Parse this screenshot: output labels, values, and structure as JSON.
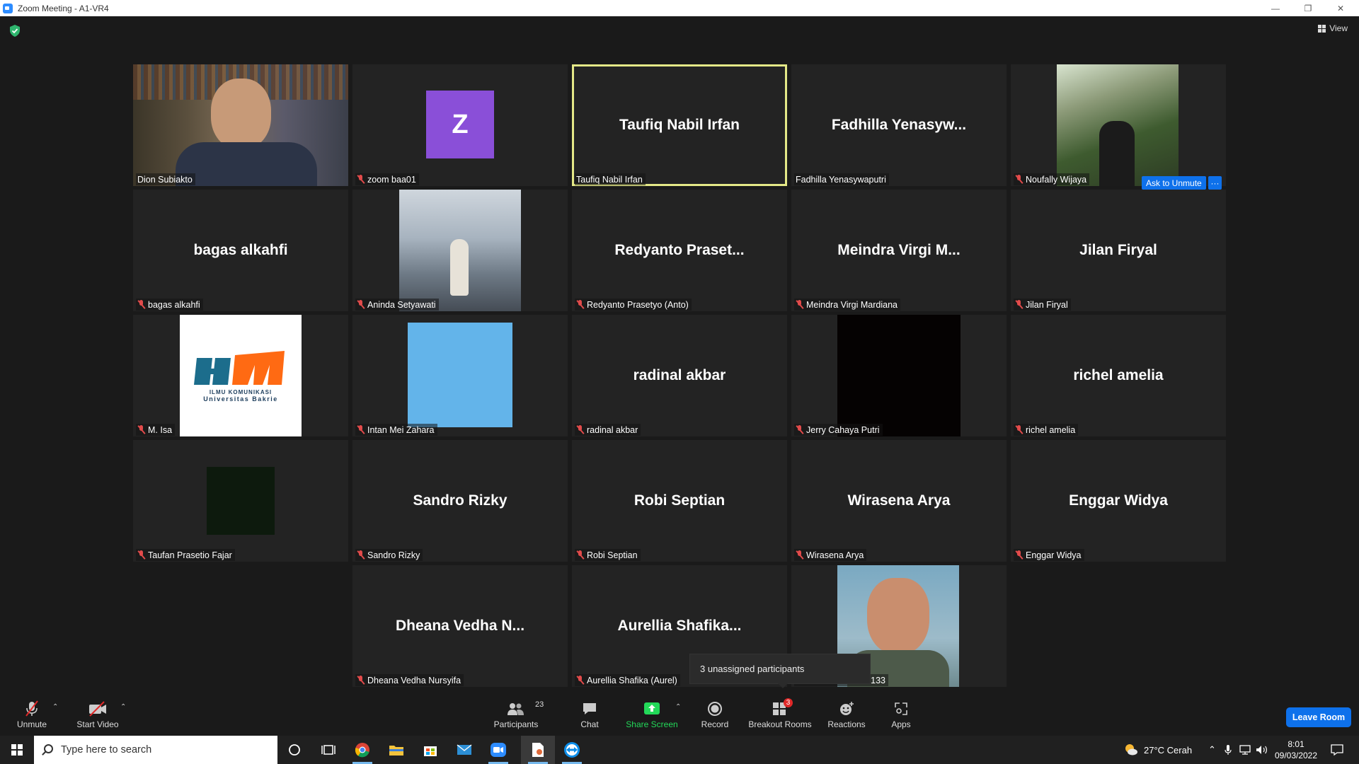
{
  "window": {
    "title": "Zoom Meeting - A1-VR4"
  },
  "meeting": {
    "view_label": "View",
    "ask_to_unmute_label": "Ask to Unmute",
    "ask_more_label": "···",
    "unassigned_tooltip": "3 unassigned participants",
    "tiles": [
      {
        "name": "Dion Subiakto",
        "display": "",
        "muted": false,
        "kind": "video"
      },
      {
        "name": "zoom baa01",
        "display": "",
        "muted": true,
        "kind": "avatar",
        "avatar_letter": "Z",
        "avatar_color": "#8a4fd8"
      },
      {
        "name": "Taufiq Nabil Irfan",
        "display": "Taufiq Nabil Irfan",
        "muted": false,
        "kind": "name",
        "active_speaker": true
      },
      {
        "name": "Fadhilla Yenasywaputri",
        "display": "Fadhilla  Yenasyw...",
        "muted": false,
        "kind": "name"
      },
      {
        "name": "Noufally Wijaya",
        "display": "",
        "muted": true,
        "kind": "photo"
      },
      {
        "name": "bagas alkahfi",
        "display": "bagas alkahfi",
        "muted": true,
        "kind": "name"
      },
      {
        "name": "Aninda Setyawati",
        "display": "",
        "muted": true,
        "kind": "photo"
      },
      {
        "name": "Redyanto Prasetyo (Anto)",
        "display": "Redyanto  Praset...",
        "muted": true,
        "kind": "name"
      },
      {
        "name": "Meindra Virgi Mardiana",
        "display": "Meindra Virgi M...",
        "muted": true,
        "kind": "name"
      },
      {
        "name": "Jilan Firyal",
        "display": "Jilan Firyal",
        "muted": true,
        "kind": "name"
      },
      {
        "name": "M. Isa",
        "display": "",
        "muted": true,
        "kind": "logo",
        "logo_caption_1": "ILMU KOMUNIKASI",
        "logo_caption_2": "Universitas Bakrie"
      },
      {
        "name": "Intan Mei Zahara",
        "display": "",
        "muted": true,
        "kind": "color",
        "color": "#63b4ea"
      },
      {
        "name": "radinal akbar",
        "display": "radinal akbar",
        "muted": true,
        "kind": "name"
      },
      {
        "name": "Jerry Cahaya Putri",
        "display": "",
        "muted": true,
        "kind": "color",
        "color": "#050202"
      },
      {
        "name": "richel amelia",
        "display": "richel amelia",
        "muted": true,
        "kind": "name"
      },
      {
        "name": "Taufan Prasetio Fajar",
        "display": "",
        "muted": true,
        "kind": "color",
        "color": "#0d1a0d"
      },
      {
        "name": "Sandro Rizky",
        "display": "Sandro Rizky",
        "muted": true,
        "kind": "name"
      },
      {
        "name": "Robi Septian",
        "display": "Robi Septian",
        "muted": true,
        "kind": "name"
      },
      {
        "name": "Wirasena Arya",
        "display": "Wirasena Arya",
        "muted": true,
        "kind": "name"
      },
      {
        "name": "Enggar Widya",
        "display": "Enggar Widya",
        "muted": true,
        "kind": "name"
      },
      {
        "name": "Dheana Vedha Nursyifa",
        "display": "Dheana Vedha N...",
        "muted": true,
        "kind": "name"
      },
      {
        "name": "Aurellia Shafika (Aurel)",
        "display": "Aurellia  Shafika...",
        "muted": true,
        "kind": "name"
      },
      {
        "name": "nandhito #1191003133",
        "display": "",
        "muted": false,
        "kind": "portrait"
      }
    ]
  },
  "toolbar": {
    "unmute_label": "Unmute",
    "start_video_label": "Start Video",
    "participants_label": "Participants",
    "participants_count": "23",
    "chat_label": "Chat",
    "share_screen_label": "Share Screen",
    "record_label": "Record",
    "breakout_label": "Breakout Rooms",
    "breakout_badge": "3",
    "reactions_label": "Reactions",
    "apps_label": "Apps",
    "leave_label": "Leave Room",
    "share_color": "#23d959"
  },
  "taskbar": {
    "search_placeholder": "Type here to search",
    "weather": "27°C  Cerah",
    "time": "8:01",
    "date": "09/03/2022"
  }
}
